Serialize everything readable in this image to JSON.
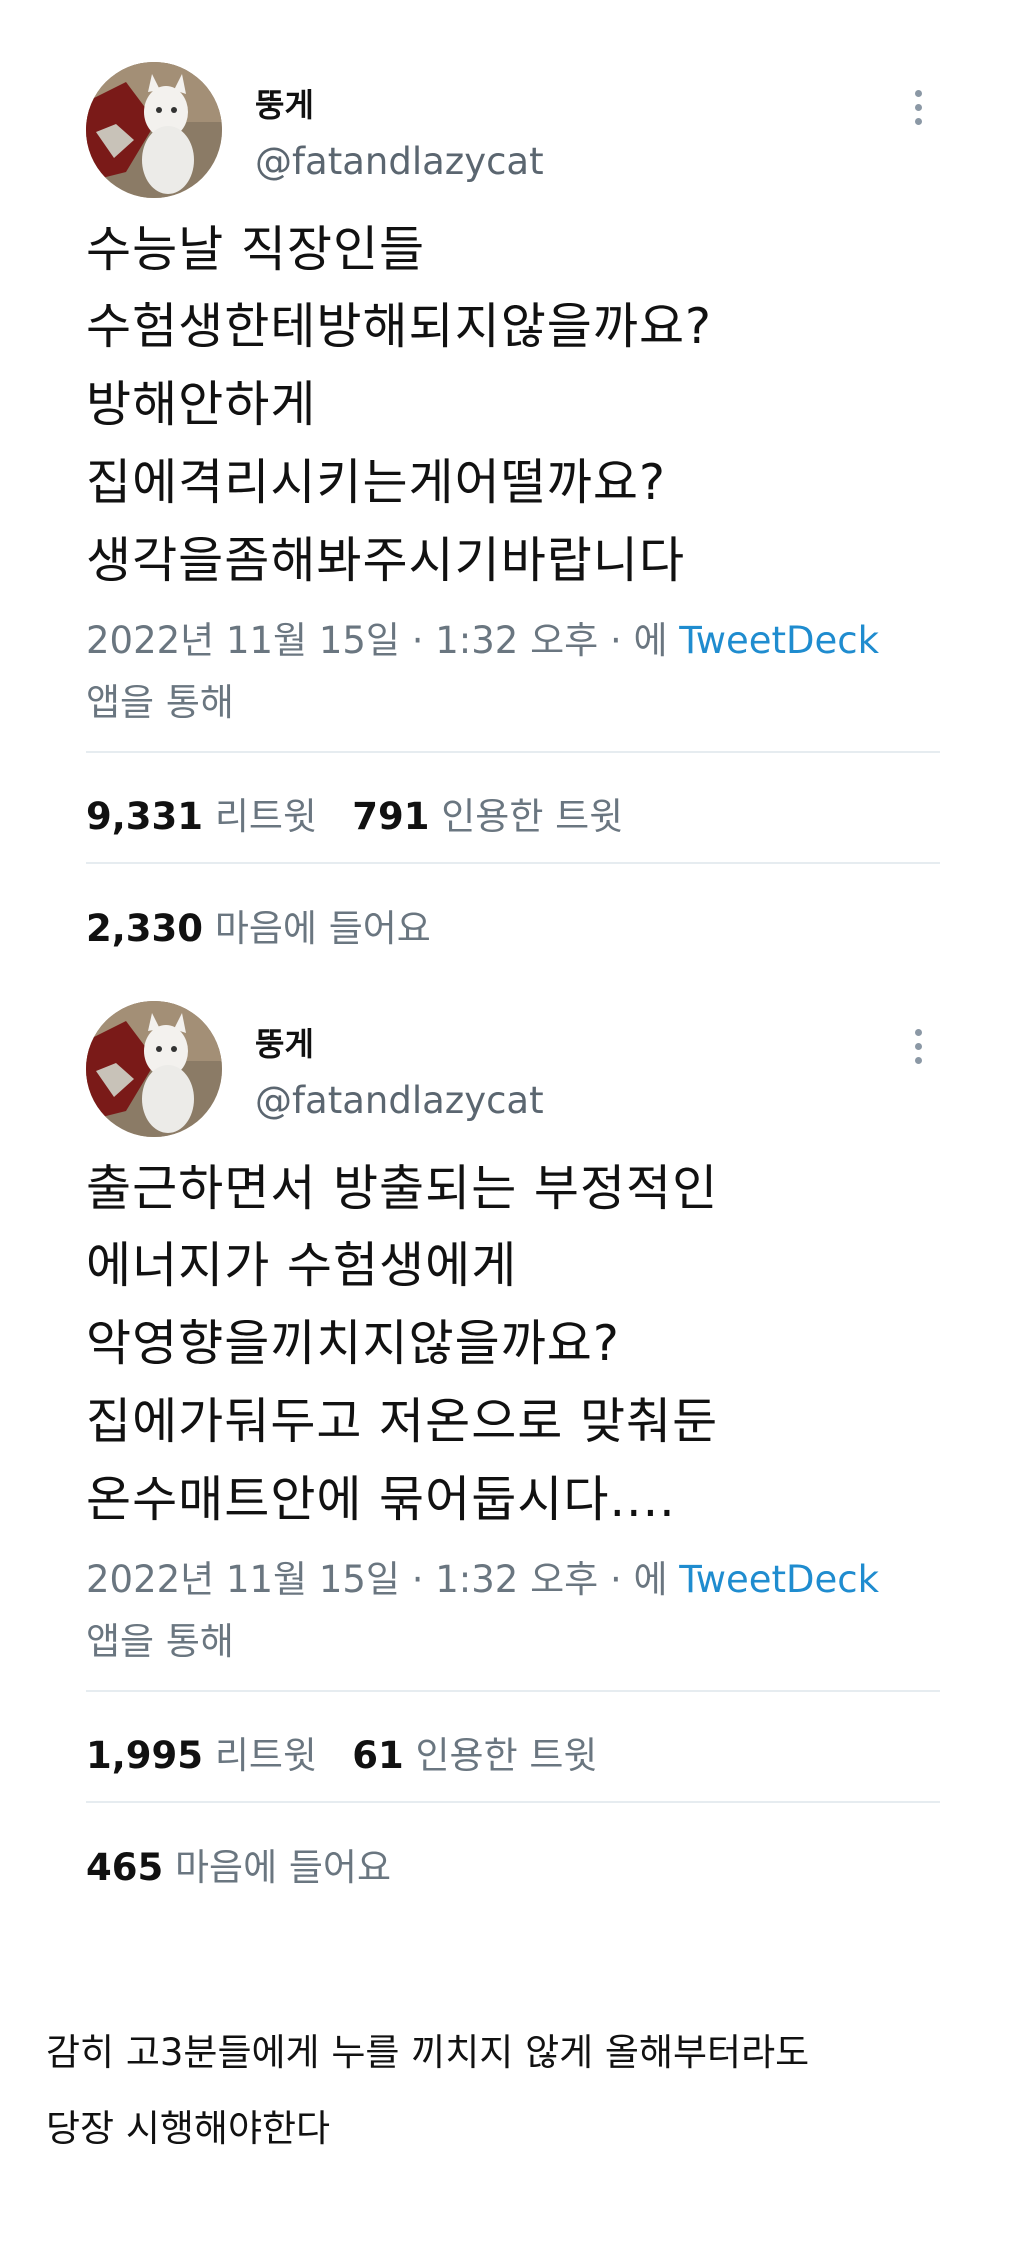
{
  "tweets": [
    {
      "display_name": "뚱게",
      "handle": "@fatandlazycat",
      "lines": [
        "수능날 직장인들",
        "수험생한테방해되지않을까요?",
        "방해안하게",
        "집에격리시키는게어떨까요?",
        "생각을좀해봐주시기바랍니다"
      ],
      "timestamp": "2022년 11월 15일 · 1:32 오후 · 에",
      "source_app": "TweetDeck",
      "via": "앱을 통해",
      "retweets": "9,331",
      "retweets_label": "리트윗",
      "quotes": "791",
      "quotes_label": "인용한 트윗",
      "likes": "2,330",
      "likes_label": "마음에 들어요"
    },
    {
      "display_name": "뚱게",
      "handle": "@fatandlazycat",
      "lines": [
        "출근하면서 방출되는 부정적인",
        "에너지가 수험생에게",
        "악영향을끼치지않을까요?",
        "집에가둬두고 저온으로 맞춰둔",
        "온수매트안에 묶어둡시다...."
      ],
      "timestamp": "2022년 11월 15일 · 1:32 오후 · 에",
      "source_app": "TweetDeck",
      "via": "앱을 통해",
      "retweets": "1,995",
      "retweets_label": "리트윗",
      "quotes": "61",
      "quotes_label": "인용한 트윗",
      "likes": "465",
      "likes_label": "마음에 들어요"
    }
  ],
  "caption": {
    "line1": "감히 고3분들에게 누를 끼치지 않게 올해부터라도",
    "line2": "당장 시행해야한다"
  },
  "colors": {
    "link": "#1f8ccf",
    "muted": "#6a7680",
    "divider": "#e6ecf0"
  }
}
